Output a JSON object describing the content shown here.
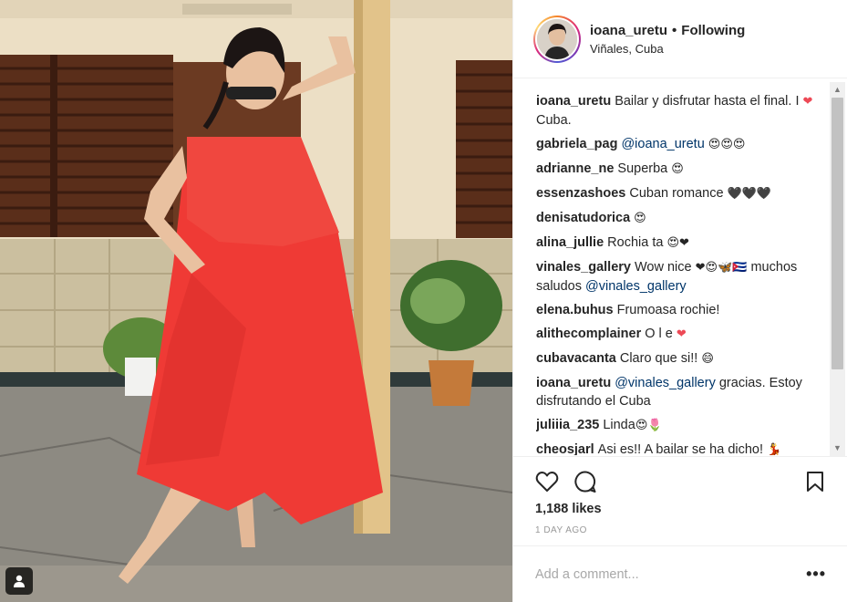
{
  "post": {
    "username": "ioana_uretu",
    "separator": "•",
    "follow_status": "Following",
    "location": "Viñales, Cuba",
    "likes": "1,188 likes",
    "time_ago": "1 DAY AGO",
    "comment_placeholder": "Add a comment...",
    "more_label": "•••"
  },
  "comments": [
    {
      "user": "ioana_uretu",
      "text": "Bailar y disfrutar hasta el final. I ",
      "emoji": "❤",
      "tail": " Cuba."
    },
    {
      "user": "gabriela_pag",
      "mention": "@ioana_uretu",
      "text": "",
      "emoji": "😍😍😍",
      "tail": ""
    },
    {
      "user": "adrianne_ne",
      "text": "Superba ",
      "emoji": "😍",
      "tail": ""
    },
    {
      "user": "essenzashoes",
      "text": "Cuban romance ",
      "emoji": "🖤🖤🖤",
      "tail": ""
    },
    {
      "user": "denisatudorica",
      "text": "",
      "emoji": "😍",
      "tail": ""
    },
    {
      "user": "alina_jullie",
      "text": "Rochia ta ",
      "emoji": "😍❤",
      "tail": ""
    },
    {
      "user": "vinales_gallery",
      "text": "Wow nice ",
      "emoji": "❤😍🦋🇨🇺",
      "tail": " muchos saludos ",
      "mention_after": "@vinales_gallery"
    },
    {
      "user": "elena.buhus",
      "text": "Frumoasa rochie!",
      "emoji": "",
      "tail": ""
    },
    {
      "user": "alithecomplainer",
      "text": "O l e ",
      "emoji": "❤",
      "tail": ""
    },
    {
      "user": "cubavacanta",
      "text": "Claro que si!! ",
      "emoji": "😄",
      "tail": ""
    },
    {
      "user": "ioana_uretu",
      "mention": "@vinales_gallery",
      "text": " gracias. Estoy disfrutando el Cuba",
      "emoji": "",
      "tail": ""
    },
    {
      "user": "juliiia_235",
      "text": "Linda",
      "emoji": "😍🌷",
      "tail": ""
    },
    {
      "user": "cheosjarl",
      "text": "Asi es!! A bailar se ha dicho! ",
      "emoji": "💃",
      "tail": ""
    }
  ],
  "colors": {
    "heart": "#ed4956",
    "mention": "#003569",
    "dress": "#ef3a35",
    "wall": "#eadcc0"
  },
  "icons": {
    "like": "heart-outline-icon",
    "comment": "speech-bubble-icon",
    "save": "bookmark-icon",
    "tag": "person-tag-icon"
  }
}
